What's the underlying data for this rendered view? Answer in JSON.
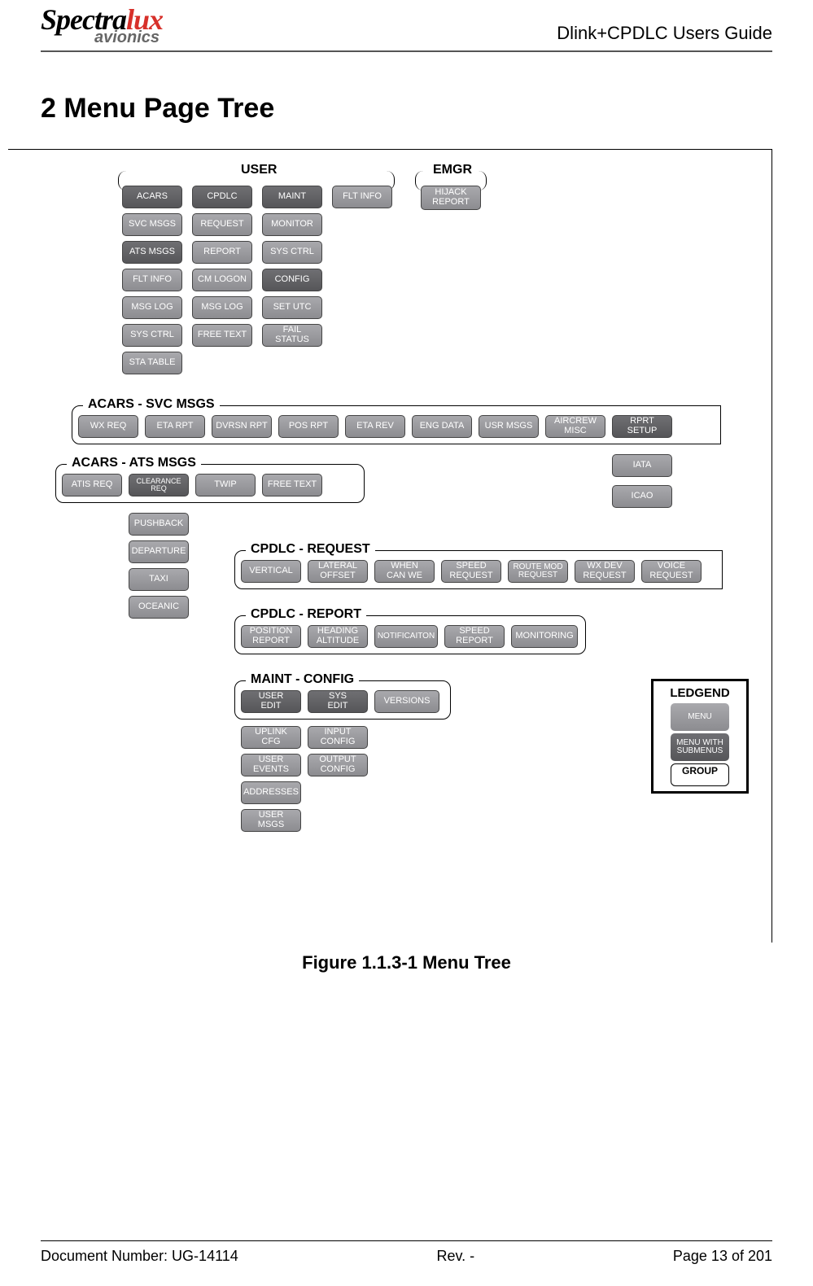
{
  "header": {
    "logo_a": "Spectra",
    "logo_b": "lux",
    "logo_sub": "avionics",
    "doc_title": "Dlink+CPDLC Users Guide"
  },
  "section_heading": "2  Menu Page Tree",
  "groups": {
    "user": "USER",
    "emgr": "EMGR",
    "svc": "ACARS - SVC MSGS",
    "ats": "ACARS - ATS MSGS",
    "req": "CPDLC - REQUEST",
    "rep": "CPDLC - REPORT",
    "cfg": "MAINT - CONFIG"
  },
  "btns": {
    "user_c1": [
      "ACARS",
      "SVC MSGS",
      "ATS MSGS",
      "FLT INFO",
      "MSG LOG",
      "SYS CTRL",
      "STA TABLE"
    ],
    "user_c2": [
      "CPDLC",
      "REQUEST",
      "REPORT",
      "CM LOGON",
      "MSG LOG",
      "FREE TEXT"
    ],
    "user_c3": [
      "MAINT",
      "MONITOR",
      "SYS CTRL",
      "CONFIG",
      "SET UTC",
      "FAIL\nSTATUS"
    ],
    "user_c4": [
      "FLT INFO"
    ],
    "emgr": [
      "HIJACK\nREPORT"
    ],
    "svc_row": [
      "WX REQ",
      "ETA RPT",
      "DVRSN RPT",
      "POS RPT",
      "ETA REV",
      "ENG DATA",
      "USR MSGS",
      "AIRCREW\nMISC",
      "RPRT\nSETUP"
    ],
    "side": [
      "IATA",
      "ICAO"
    ],
    "ats_row": [
      "ATIS REQ",
      "CLEARANCE\nREQ",
      "TWIP",
      "FREE TEXT"
    ],
    "clr_sub": [
      "PUSHBACK",
      "DEPARTURE",
      "TAXI",
      "OCEANIC"
    ],
    "req_row": [
      "VERTICAL",
      "LATERAL\nOFFSET",
      "WHEN\nCAN WE",
      "SPEED\nREQUEST",
      "ROUTE MOD\nREQUEST",
      "WX DEV\nREQUEST",
      "VOICE\nREQUEST"
    ],
    "rep_row": [
      "POSITION\nREPORT",
      "HEADING\nALTITUDE",
      "NOTIFICAITON",
      "SPEED\nREPORT",
      "MONITORING"
    ],
    "cfg_top": [
      "USER\nEDIT",
      "SYS\nEDIT",
      "VERSIONS"
    ],
    "cfg_c1": [
      "UPLINK\nCFG",
      "USER\nEVENTS",
      "ADDRESSES",
      "USER\nMSGS"
    ],
    "cfg_c2": [
      "INPUT\nCONFIG",
      "OUTPUT\nCONFIG"
    ]
  },
  "legend": {
    "title": "LEDGEND",
    "menu": "MENU",
    "menu_sub": "MENU\nWITH\nSUBMENUS",
    "group": "GROUP"
  },
  "figure_caption": "Figure 1.1.3-1 Menu Tree",
  "footer": {
    "left": "Document Number:  UG-14114",
    "mid": "Rev. -",
    "right": "Page 13 of 201"
  },
  "chart_data": {
    "type": "tree",
    "title": "Menu Tree",
    "groups": [
      {
        "name": "USER",
        "columns": [
          {
            "head": "ACARS",
            "style": "submenu",
            "children": [
              "SVC MSGS",
              "ATS MSGS",
              "FLT INFO",
              "MSG LOG",
              "SYS CTRL",
              "STA TABLE"
            ]
          },
          {
            "head": "CPDLC",
            "style": "submenu",
            "children": [
              "REQUEST",
              "REPORT",
              "CM LOGON",
              "MSG LOG",
              "FREE TEXT"
            ]
          },
          {
            "head": "MAINT",
            "style": "submenu",
            "children": [
              "MONITOR",
              "SYS CTRL",
              "CONFIG",
              "SET UTC",
              "FAIL STATUS"
            ]
          },
          {
            "head": "FLT INFO",
            "style": "menu",
            "children": []
          }
        ]
      },
      {
        "name": "EMGR",
        "columns": [
          {
            "head": null,
            "children": [
              "HIJACK REPORT"
            ]
          }
        ]
      },
      {
        "name": "ACARS - SVC MSGS",
        "row": [
          "WX REQ",
          "ETA RPT",
          "DVRSN RPT",
          "POS RPT",
          "ETA REV",
          "ENG DATA",
          "USR MSGS",
          "AIRCREW MISC",
          "RPRT SETUP"
        ],
        "rprt_setup_children": [
          "IATA",
          "ICAO"
        ]
      },
      {
        "name": "ACARS - ATS MSGS",
        "row": [
          "ATIS REQ",
          "CLEARANCE REQ",
          "TWIP",
          "FREE TEXT"
        ],
        "clearance_req_children": [
          "PUSHBACK",
          "DEPARTURE",
          "TAXI",
          "OCEANIC"
        ]
      },
      {
        "name": "CPDLC - REQUEST",
        "row": [
          "VERTICAL",
          "LATERAL OFFSET",
          "WHEN CAN WE",
          "SPEED REQUEST",
          "ROUTE MOD REQUEST",
          "WX DEV REQUEST",
          "VOICE REQUEST"
        ]
      },
      {
        "name": "CPDLC - REPORT",
        "row": [
          "POSITION REPORT",
          "HEADING ALTITUDE",
          "NOTIFICAITON",
          "SPEED REPORT",
          "MONITORING"
        ]
      },
      {
        "name": "MAINT - CONFIG",
        "top_row": [
          "USER EDIT",
          "SYS EDIT",
          "VERSIONS"
        ],
        "user_edit_children": [
          "UPLINK CFG",
          "USER EVENTS",
          "ADDRESSES",
          "USER MSGS"
        ],
        "sys_edit_children": [
          "INPUT CONFIG",
          "OUTPUT CONFIG"
        ]
      }
    ],
    "legend": {
      "MENU": "plain menu",
      "MENU WITH SUBMENUS": "has submenus",
      "GROUP": "group container"
    }
  }
}
